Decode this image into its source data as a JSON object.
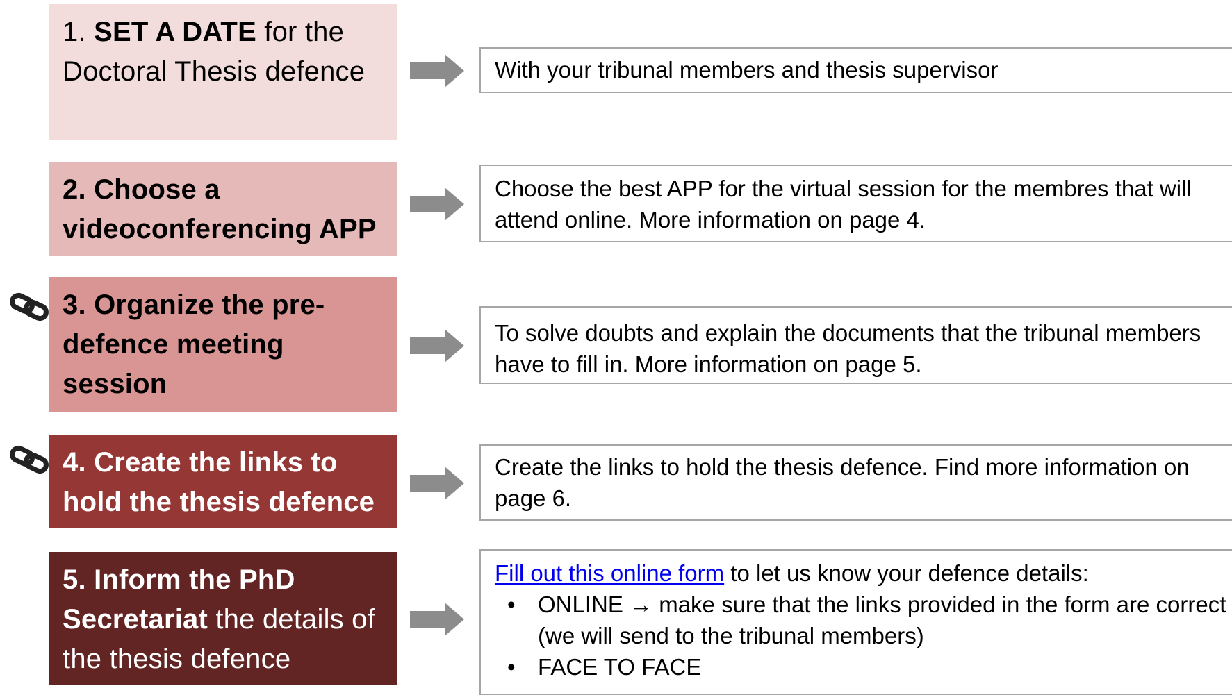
{
  "steps": [
    {
      "number": "1.",
      "bold": "SET A DATE",
      "rest": " for the Doctoral Thesis defence"
    },
    {
      "number": "2.",
      "text": "Choose a videoconferencing APP"
    },
    {
      "number": "3.",
      "text": "Organize the pre-defence meeting session"
    },
    {
      "number": "4.",
      "text": "Create the links to hold the thesis defence"
    },
    {
      "number": "5.",
      "bold": "Inform the PhD Secretariat",
      "rest": " the details of the thesis defence"
    }
  ],
  "descriptions": {
    "box1": "With your tribunal members and thesis supervisor",
    "box2": "Choose the best APP for the virtual session for the membres that will attend online. More information on page 4.",
    "box3": "To solve doubts and explain the documents that the tribunal members have to fill in. More information on page 5.",
    "box4": "Create the links to hold the thesis defence. Find more information on page 6.",
    "box5": {
      "link_text": " Fill out this online form",
      "after_link": " to let us know your defence details:",
      "bullet_char": "•",
      "bullets": [
        "ONLINE → make sure that the links provided in the form are correct (we will send to the tribunal members)",
        "FACE TO FACE"
      ]
    }
  },
  "colors": {
    "step1": "#f2dcdc",
    "step2": "#e6b9b9",
    "step3": "#d99494",
    "step4": "#953735",
    "step5": "#632523",
    "arrow": "#8c8c8c",
    "border": "#a6a6a6"
  },
  "icons": [
    "right-arrow-icon",
    "link-chain-icon"
  ]
}
